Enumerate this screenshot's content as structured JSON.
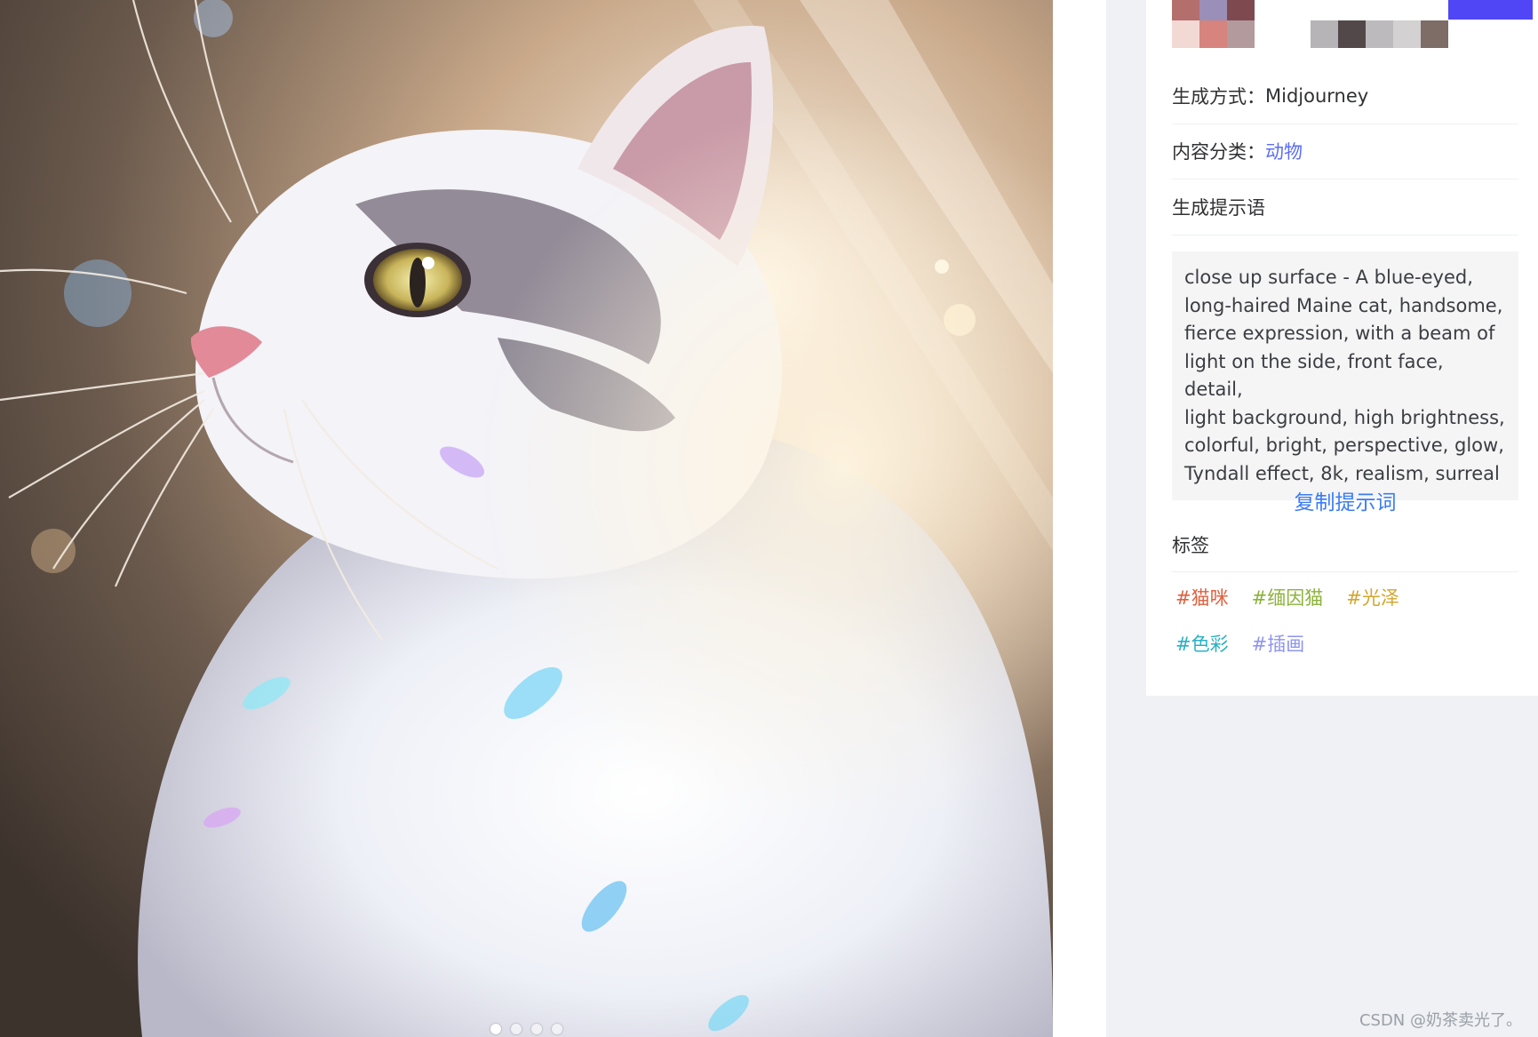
{
  "detail": {
    "generation_method_label": "生成方式：",
    "generation_method_value": "Midjourney",
    "category_label": "内容分类：",
    "category_value": "动物",
    "prompt_label": "生成提示语",
    "prompt_text": "close up surface - A blue-eyed,\nlong-haired Maine cat, handsome,\nfierce expression, with a beam of\nlight on the side, front face, detail,\nlight background, high brightness,\ncolorful, bright, perspective, glow,\nTyndall effect, 8k, realism, surreal",
    "copy_button_label": "复制提示词",
    "tags_label": "标签",
    "tags": [
      {
        "text": "#猫咪",
        "color": "#e0603f"
      },
      {
        "text": "#缅因猫",
        "color": "#8bb23a"
      },
      {
        "text": "#光泽",
        "color": "#d4a630"
      },
      {
        "text": "#色彩",
        "color": "#2bb0c4"
      },
      {
        "text": "#插画",
        "color": "#8d95f0"
      }
    ]
  },
  "palette_colors": [
    "#b46e6c",
    "#9a8fb8",
    "#7e4a50",
    "#f3d9d4",
    "#d6847d",
    "#b39a9c",
    "#b6b4b6",
    "#52484a",
    "#bcbabc",
    "#d3d1d1",
    "#7e6c66",
    "#5046f5"
  ],
  "carousel": {
    "total": 4,
    "active": 0
  },
  "watermark": "CSDN @奶茶卖光了。"
}
